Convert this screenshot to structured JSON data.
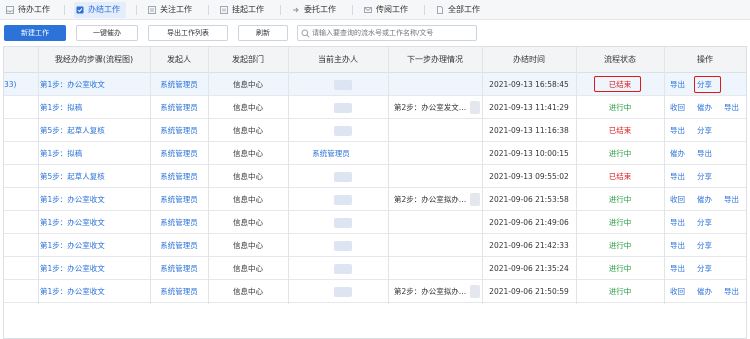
{
  "tabs": [
    {
      "label": "待办工作",
      "icon": "inbox-icon"
    },
    {
      "label": "办结工作",
      "icon": "clipboard-check-icon"
    },
    {
      "label": "关注工作",
      "icon": "star-list-icon"
    },
    {
      "label": "挂起工作",
      "icon": "pause-icon"
    },
    {
      "label": "委托工作",
      "icon": "delegate-icon"
    },
    {
      "label": "传阅工作",
      "icon": "share-read-icon"
    },
    {
      "label": "全部工作",
      "icon": "document-icon"
    }
  ],
  "toolbar": {
    "new_label": "新建工作",
    "oneclick_label": "一键催办",
    "export_label": "导出工作列表",
    "refresh_label": "刷新",
    "search_placeholder": "请输入要查询的流水号或工作名称/文号"
  },
  "headers": [
    "我经办的步骤(流程图)",
    "发起人",
    "发起部门",
    "当前主办人",
    "下一步办理情况",
    "办结时间",
    "流程状态",
    "操作"
  ],
  "rows": [
    {
      "lead": "33)",
      "step": "第1步：办公室收文",
      "initiator": "系统管理员",
      "dept": "信息中心",
      "handler": "",
      "next": "",
      "time": "2021-09-13 16:58:45",
      "status": "已结束",
      "status_color": "red",
      "ops": [
        "导出",
        "分享"
      ]
    },
    {
      "lead": "",
      "step": "第1步：拟稿",
      "initiator": "系统管理员",
      "dept": "信息中心",
      "handler": "",
      "next": "第2步：办公室发文…",
      "time": "2021-09-13 11:41:29",
      "status": "进行中",
      "status_color": "green",
      "ops": [
        "收回",
        "催办",
        "导出"
      ]
    },
    {
      "lead": "",
      "step": "第5步：起草人复核",
      "initiator": "系统管理员",
      "dept": "信息中心",
      "handler": "",
      "next": "",
      "time": "2021-09-13 11:16:38",
      "status": "已结束",
      "status_color": "red",
      "ops": [
        "导出",
        "分享"
      ]
    },
    {
      "lead": "",
      "step": "第1步：拟稿",
      "initiator": "系统管理员",
      "dept": "信息中心",
      "handler": "系统管理员",
      "next": "",
      "time": "2021-09-13 10:00:15",
      "status": "进行中",
      "status_color": "green",
      "ops": [
        "催办",
        "导出"
      ]
    },
    {
      "lead": "",
      "step": "第5步：起草人复核",
      "initiator": "系统管理员",
      "dept": "信息中心",
      "handler": "",
      "next": "",
      "time": "2021-09-13 09:55:02",
      "status": "已结束",
      "status_color": "red",
      "ops": [
        "导出",
        "分享"
      ]
    },
    {
      "lead": "",
      "step": "第1步：办公室收文",
      "initiator": "系统管理员",
      "dept": "信息中心",
      "handler": "",
      "next": "第2步：办公室拟办…",
      "time": "2021-09-06 21:53:58",
      "status": "进行中",
      "status_color": "green",
      "ops": [
        "收回",
        "催办",
        "导出"
      ]
    },
    {
      "lead": "",
      "step": "第1步：办公室收文",
      "initiator": "系统管理员",
      "dept": "信息中心",
      "handler": "",
      "next": "",
      "time": "2021-09-06 21:49:06",
      "status": "进行中",
      "status_color": "green",
      "ops": [
        "导出",
        "分享"
      ]
    },
    {
      "lead": "",
      "step": "第1步：办公室收文",
      "initiator": "系统管理员",
      "dept": "信息中心",
      "handler": "",
      "next": "",
      "time": "2021-09-06 21:42:33",
      "status": "进行中",
      "status_color": "green",
      "ops": [
        "导出",
        "分享"
      ]
    },
    {
      "lead": "",
      "step": "第1步：办公室收文",
      "initiator": "系统管理员",
      "dept": "信息中心",
      "handler": "",
      "next": "",
      "time": "2021-09-06 21:35:24",
      "status": "进行中",
      "status_color": "green",
      "ops": [
        "导出",
        "分享"
      ]
    },
    {
      "lead": "",
      "step": "第1步：办公室收文",
      "initiator": "系统管理员",
      "dept": "信息中心",
      "handler": "",
      "next": "第2步：办公室拟办…",
      "time": "2021-09-06 21:50:59",
      "status": "进行中",
      "status_color": "green",
      "ops": [
        "收回",
        "催办",
        "导出"
      ]
    }
  ],
  "colors": {
    "primary": "#2b73d9",
    "ended": "#e02020",
    "running": "#1e9b3a",
    "highlight": "#e01818"
  }
}
